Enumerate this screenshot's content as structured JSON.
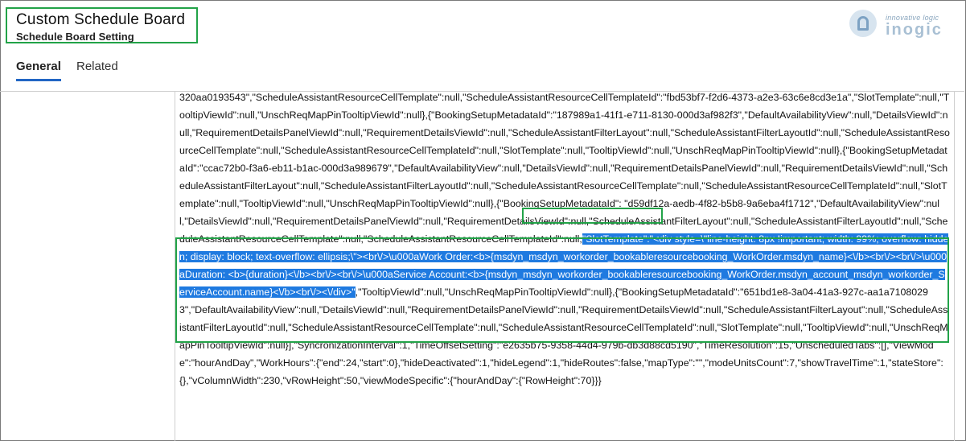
{
  "header": {
    "title": "Custom Schedule Board",
    "subtitle": "Schedule Board Setting"
  },
  "logo": {
    "tagline": "innovative logic",
    "name": "inogic",
    "icon": "inogic-logo-icon"
  },
  "tabs": [
    {
      "label": "General",
      "selected": true
    },
    {
      "label": "Related",
      "selected": false
    }
  ],
  "colors": {
    "highlight_border": "#22a348",
    "selection": "#1f7ae0",
    "tab_underline": "#2266c4"
  },
  "code": {
    "part1": "320aa0193543\",\"ScheduleAssistantResourceCellTemplate\":null,\"ScheduleAssistantResourceCellTemplateId\":\"fbd53bf7-f2d6-4373-a2e3-63c6e8cd3e1a\",\"SlotTemplate\":null,\"TooltipViewId\":null,\"UnschReqMapPinTooltipViewId\":null},{\"BookingSetupMetadataId\":\"187989a1-41f1-e711-8130-000d3af982f3\",\"DefaultAvailabilityView\":null,\"DetailsViewId\":null,\"RequirementDetailsPanelViewId\":null,\"RequirementDetailsViewId\":null,\"ScheduleAssistantFilterLayout\":null,\"ScheduleAssistantFilterLayoutId\":null,\"ScheduleAssistantResourceCellTemplate\":null,\"ScheduleAssistantResourceCellTemplateId\":null,\"SlotTemplate\":null,\"TooltipViewId\":null,\"UnschReqMapPinTooltipViewId\":null},{\"BookingSetupMetadataId\":\"ccac72b0-f3a6-eb11-b1ac-000d3a989679\",\"DefaultAvailabilityView\":null,\"DetailsViewId\":null,\"RequirementDetailsPanelViewId\":null,\"RequirementDetailsViewId\":null,\"ScheduleAssistantFilterLayout\":null,\"ScheduleAssistantFilterLayoutId\":null,\"ScheduleAssistantResourceCellTemplate\":null,\"ScheduleAssistantResourceCellTemplateId\":null,\"SlotTemplate\":null,\"TooltipViewId\":null,\"UnschReqMapPinTooltipViewId\":null},{",
    "boxed_key": "\"BookingSetupMetadataId\":",
    "part2": "\"d59df12a-aedb-4f82-b5b8-9a6eba4f1712\",\"DefaultAvailabilityView\":null,\"DetailsViewId\":null,\"RequirementDetailsPanelViewId\":null,\"RequirementDetailsViewId\":null,\"ScheduleAssistantFilterLayout\":null,\"ScheduleAssistantFilterLayoutId\":null,\"ScheduleAssistantResourceCellTemplate\":null,\"ScheduleAssistantResourceCellTemplateId\":null,",
    "selected": "\"SlotTemplate\":\"<div style=\\\"line-height: 8px !important; width: 99%; overflow: hidden; display: block; text-overflow: ellipsis;\\\"><br\\/>\\u000aWork Order:<b>{msdyn_msdyn_workorder_bookableresourcebooking_WorkOrder.msdyn_name}<\\/b><br\\/><br\\/>\\u000aDuration: <b>{duration}<\\/b><br\\/><br\\/>\\u000aService Account:<b>{msdyn_msdyn_workorder_bookableresourcebooking_WorkOrder.msdyn_account_msdyn_workorder_ServiceAccount.name}<\\/b><br\\/><\\/div>\"",
    "part3": ",\"TooltipViewId\":null,\"UnschReqMapPinTooltipViewId\":null},{\"BookingSetupMetadataId\":\"651bd1e8-3a04-41a3-927c-aa1a71080293\",\"DefaultAvailabilityView\":null,\"DetailsViewId\":null,\"RequirementDetailsPanelViewId\":null,\"RequirementDetailsViewId\":null,\"ScheduleAssistantFilterLayout\":null,\"ScheduleAssistantFilterLayoutId\":null,\"ScheduleAssistantResourceCellTemplate\":null,\"ScheduleAssistantResourceCellTemplateId\":null,\"SlotTemplate\":null,\"TooltipViewId\":null,\"UnschReqMapPinTooltipViewId\":null}],\"SyncronizationInterval\":1,\"TimeOffsetSetting\":\"e2635b75-9358-44d4-979b-db3d88cd5190\",\"TimeResolution\":15,\"UnscheduledTabs\":[],\"ViewMode\":\"hourAndDay\",\"WorkHours\":{\"end\":24,\"start\":0},\"hideDeactivated\":1,\"hideLegend\":1,\"hideRoutes\":false,\"mapType\":\"\",\"modeUnitsCount\":7,\"showTravelTime\":1,\"stateStore\":{},\"vColumnWidth\":230,\"vRowHeight\":50,\"viewModeSpecific\":{\"hourAndDay\":{\"RowHeight\":70}}}"
  }
}
